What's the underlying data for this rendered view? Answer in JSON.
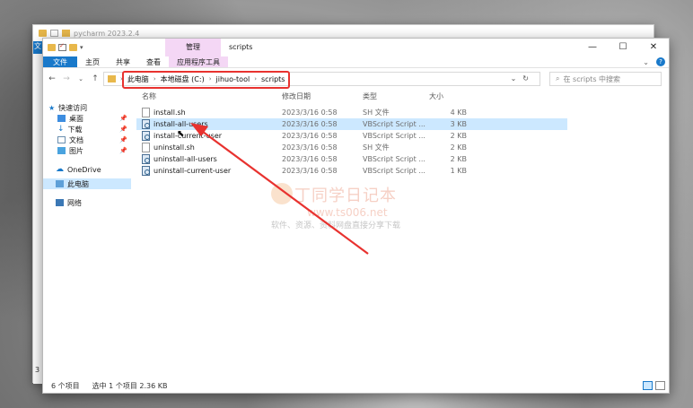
{
  "back_window": {
    "title": "pycharm 2023.2.4",
    "left_tab": "文",
    "edge_number": "3"
  },
  "window": {
    "context_tab": "管理",
    "title": "scripts",
    "controls": [
      "—",
      "☐",
      "✕"
    ],
    "ribbon_tabs": [
      "文件",
      "主页",
      "共享",
      "查看",
      "应用程序工具"
    ]
  },
  "address": {
    "crumbs": [
      "此电脑",
      "本地磁盘 (C:)",
      "jihuo-tool",
      "scripts"
    ],
    "search_placeholder": "在 scripts 中搜索"
  },
  "sidebar": {
    "items": [
      {
        "label": "快速访问",
        "icon": "star-icon"
      },
      {
        "label": "桌面",
        "icon": "desktop-icon",
        "pinned": true
      },
      {
        "label": "下载",
        "icon": "download-icon",
        "pinned": true
      },
      {
        "label": "文档",
        "icon": "document-icon",
        "pinned": true
      },
      {
        "label": "图片",
        "icon": "picture-icon",
        "pinned": true
      },
      {
        "label": "OneDrive",
        "icon": "cloud-icon"
      },
      {
        "label": "此电脑",
        "icon": "computer-icon",
        "selected": true
      },
      {
        "label": "网络",
        "icon": "network-icon"
      }
    ]
  },
  "file_list": {
    "columns": [
      "名称",
      "修改日期",
      "类型",
      "大小"
    ],
    "rows": [
      {
        "name": "install.sh",
        "date": "2023/3/16 0:58",
        "type": "SH 文件",
        "size": "4 KB",
        "icon": "file-icon"
      },
      {
        "name": "install-all-users",
        "date": "2023/3/16 0:58",
        "type": "VBScript Script ...",
        "size": "3 KB",
        "icon": "vbscript-icon",
        "selected": true
      },
      {
        "name": "install-current-user",
        "date": "2023/3/16 0:58",
        "type": "VBScript Script ...",
        "size": "2 KB",
        "icon": "vbscript-icon"
      },
      {
        "name": "uninstall.sh",
        "date": "2023/3/16 0:58",
        "type": "SH 文件",
        "size": "2 KB",
        "icon": "file-icon"
      },
      {
        "name": "uninstall-all-users",
        "date": "2023/3/16 0:58",
        "type": "VBScript Script ...",
        "size": "2 KB",
        "icon": "vbscript-icon"
      },
      {
        "name": "uninstall-current-user",
        "date": "2023/3/16 0:58",
        "type": "VBScript Script ...",
        "size": "1 KB",
        "icon": "vbscript-icon"
      }
    ]
  },
  "status": {
    "count": "6 个项目",
    "selection": "选中 1 个项目  2.36 KB"
  },
  "watermark": {
    "title": "丁同学日记本",
    "url": "www.ts006.net",
    "subtitle": "软件、资源、资料网盘直接分享下载"
  },
  "colors": {
    "accent": "#1979ca",
    "selection": "#cce8ff",
    "context_tab": "#f4d7f5",
    "annotation": "#e8322f"
  }
}
